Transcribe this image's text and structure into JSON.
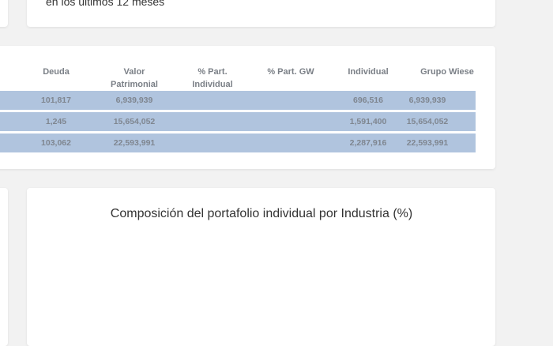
{
  "top_card": {
    "note": "en los últimos 12 meses"
  },
  "table": {
    "headers": {
      "deuda": "Deuda",
      "valor_1": "Valor",
      "valor_2": "Patrimonial",
      "part_ind_1": "% Part.",
      "part_ind_2": "Individual",
      "part_gw": "% Part. GW",
      "individual": "Individual",
      "grupo_wiese": "Grupo Wiese"
    },
    "rows": [
      {
        "deuda": "101,817",
        "valor_patrimonial": "6,939,939",
        "part_individual": "",
        "part_gw": "",
        "individual": "696,516",
        "grupo_wiese": "6,939,939"
      },
      {
        "deuda": "1,245",
        "valor_patrimonial": "15,654,052",
        "part_individual": "",
        "part_gw": "",
        "individual": "1,591,400",
        "grupo_wiese": "15,654,052"
      },
      {
        "deuda": "103,062",
        "valor_patrimonial": "22,593,991",
        "part_individual": "",
        "part_gw": "",
        "individual": "2,287,916",
        "grupo_wiese": "22,593,991"
      }
    ],
    "row_color": "#b0c4de"
  },
  "chart": {
    "title": "Composición del portafolio individual por Industria (%)"
  }
}
